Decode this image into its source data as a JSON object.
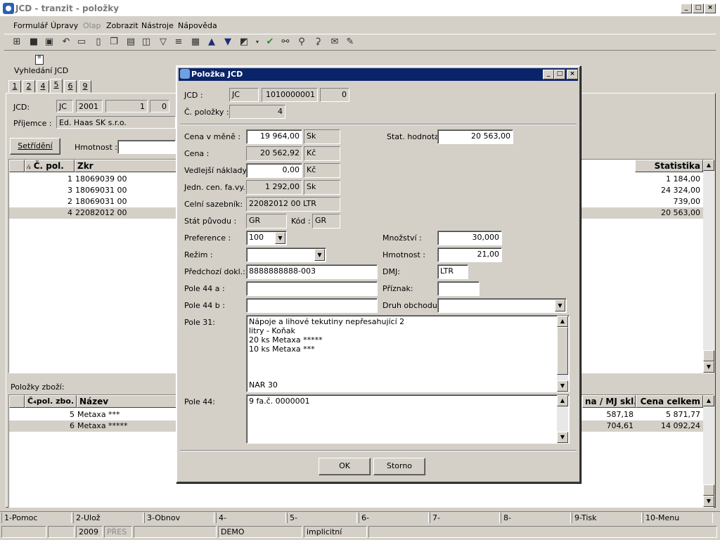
{
  "window": {
    "title": "JCD - tranzit - položky",
    "controls": {
      "minimize": "_",
      "maximize": "□",
      "close": "×"
    }
  },
  "menu": [
    "Formulář",
    "Úpravy",
    "Olap",
    "Zobrazit",
    "Nástroje",
    "Nápověda"
  ],
  "toolbar_icons": [
    "tree-icon",
    "save-icon",
    "save-all-icon",
    "undo-icon",
    "open-icon",
    "new-icon",
    "copy-icon",
    "paste-icon",
    "book-icon",
    "filter-icon",
    "filter-list-icon",
    "print-icon",
    "arrow-up-icon",
    "arrow-down-icon",
    "export-icon",
    "dropdown-icon",
    "run-icon",
    "binoculars-icon",
    "find-next-icon",
    "replace-icon",
    "mail-icon",
    "edit-icon"
  ],
  "sidebar_button": {
    "label": "Vyhledání JCD",
    "icon": "document-icon"
  },
  "tabs": [
    "1",
    "2",
    "4",
    "5",
    "6",
    "9"
  ],
  "header": {
    "jcd_label": "JCD:",
    "jcd_values": [
      "JC",
      "2001",
      "1",
      "0"
    ],
    "recipient_label": "Příjemce :",
    "recipient_value": "Ed. Haas SK s.r.o.",
    "sort_button": "Setřídění",
    "weight_label": "Hmotnost :",
    "weight_value": ""
  },
  "items_grid": {
    "columns": {
      "pos": "Č. pol.",
      "sort_icon": "⁄₄",
      "zkr": "Zkr",
      "stat": "Statistika"
    },
    "rows": [
      {
        "pos": "1",
        "zkr": "18069039 00",
        "stat": "1 184,00"
      },
      {
        "pos": "3",
        "zkr": "18069031 00",
        "stat": "24 324,00"
      },
      {
        "pos": "2",
        "zkr": "18069031 00",
        "stat": "739,00"
      },
      {
        "pos": "4",
        "zkr": "22082012 00",
        "stat": "20 563,00"
      }
    ]
  },
  "goods": {
    "label": "Položky zboží:",
    "columns": {
      "pos": "Č₄pol. zbo.",
      "name": "Název",
      "unit_price": "na / MJ skl.",
      "total": "Cena celkem"
    },
    "rows": [
      {
        "pos": "5",
        "name": "Metaxa ***",
        "unit_price": "587,18",
        "total": "5 871,77"
      },
      {
        "pos": "6",
        "name": "Metaxa *****",
        "unit_price": "704,61",
        "total": "14 092,24"
      }
    ]
  },
  "dialog": {
    "title": "Položka JCD",
    "jcd_label": "JCD :",
    "jcd_values": [
      "JC",
      "1010000001",
      "0"
    ],
    "item_no_label": "Č. položky :",
    "item_no_value": "4",
    "price_cur_label": "Cena v měně :",
    "price_cur_value": "19 964,00",
    "price_cur_unit": "Sk",
    "stat_label": "Stat. hodnota:",
    "stat_value": "20 563,00",
    "price_label": "Cena :",
    "price_value": "20 562,92",
    "price_unit": "Kč",
    "side_costs_label": "Vedlejší náklady :",
    "side_costs_value": "0,00",
    "side_costs_unit": "Kč",
    "unit_price_label": "Jedn. cen. fa.vy.:",
    "unit_price_value": "1 292,00",
    "unit_price_unit": "Sk",
    "tariff_label": "Celní sazebník:",
    "tariff_value": "22082012 00  LTR",
    "origin_label": "Stát původu :",
    "origin_value": "GR",
    "code_label": "Kód :",
    "code_value": "GR",
    "preference_label": "Preference :",
    "preference_value": "100",
    "quantity_label": "Množství :",
    "quantity_value": "30,000",
    "mode_label": "Režim :",
    "mode_value": "",
    "weight_label": "Hmotnost :",
    "weight_value": "21,00",
    "prev_doc_label": "Předchozí dokl.:",
    "prev_doc_value": "8888888888-003",
    "dmj_label": "DMJ:",
    "dmj_value": "LTR",
    "pole44a_label": "Pole 44 a :",
    "pole44a_value": "",
    "flag_label": "Příznak:",
    "flag_value": "",
    "pole44b_label": "Pole 44 b :",
    "pole44b_value": "",
    "trade_label": "Druh obchodu :",
    "trade_value": "",
    "pole31_label": "Pole 31:",
    "pole31_lines": [
      "Nápoje a lihové tekutiny nepřesahující 2",
      "litry - Koňak",
      "20 ks Metaxa *****",
      "10 ks Metaxa ***"
    ],
    "pole31_footer": "NAR  30",
    "pole44_label": "Pole 44:",
    "pole44_value": "9  fa.č. 0000001",
    "ok": "OK",
    "cancel": "Storno"
  },
  "fkeys": [
    "1-Pomoc",
    "2-Ulož",
    "3-Obnov",
    "4-",
    "5-",
    "6-",
    "7-",
    "8-",
    "9-Tisk",
    "10-Menu"
  ],
  "status": {
    "year": "2009",
    "mode": "PŘES",
    "db": "DEMO",
    "profile": "implicitní"
  }
}
